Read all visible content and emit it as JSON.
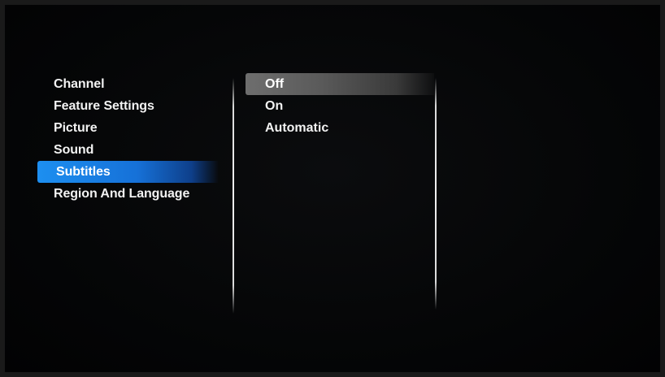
{
  "menu": {
    "items": [
      {
        "label": "Channel"
      },
      {
        "label": "Feature Settings"
      },
      {
        "label": "Picture"
      },
      {
        "label": "Sound"
      },
      {
        "label": "Subtitles"
      },
      {
        "label": "Region And Language"
      }
    ],
    "selected": "Subtitles"
  },
  "options": {
    "items": [
      {
        "label": "Off"
      },
      {
        "label": "On"
      },
      {
        "label": "Automatic"
      }
    ],
    "highlighted": "Off"
  },
  "colors": {
    "menu_selection": "#1d8ff0",
    "option_highlight": "#6e6e6e",
    "text": "#f2f2f2",
    "background": "#050607"
  }
}
